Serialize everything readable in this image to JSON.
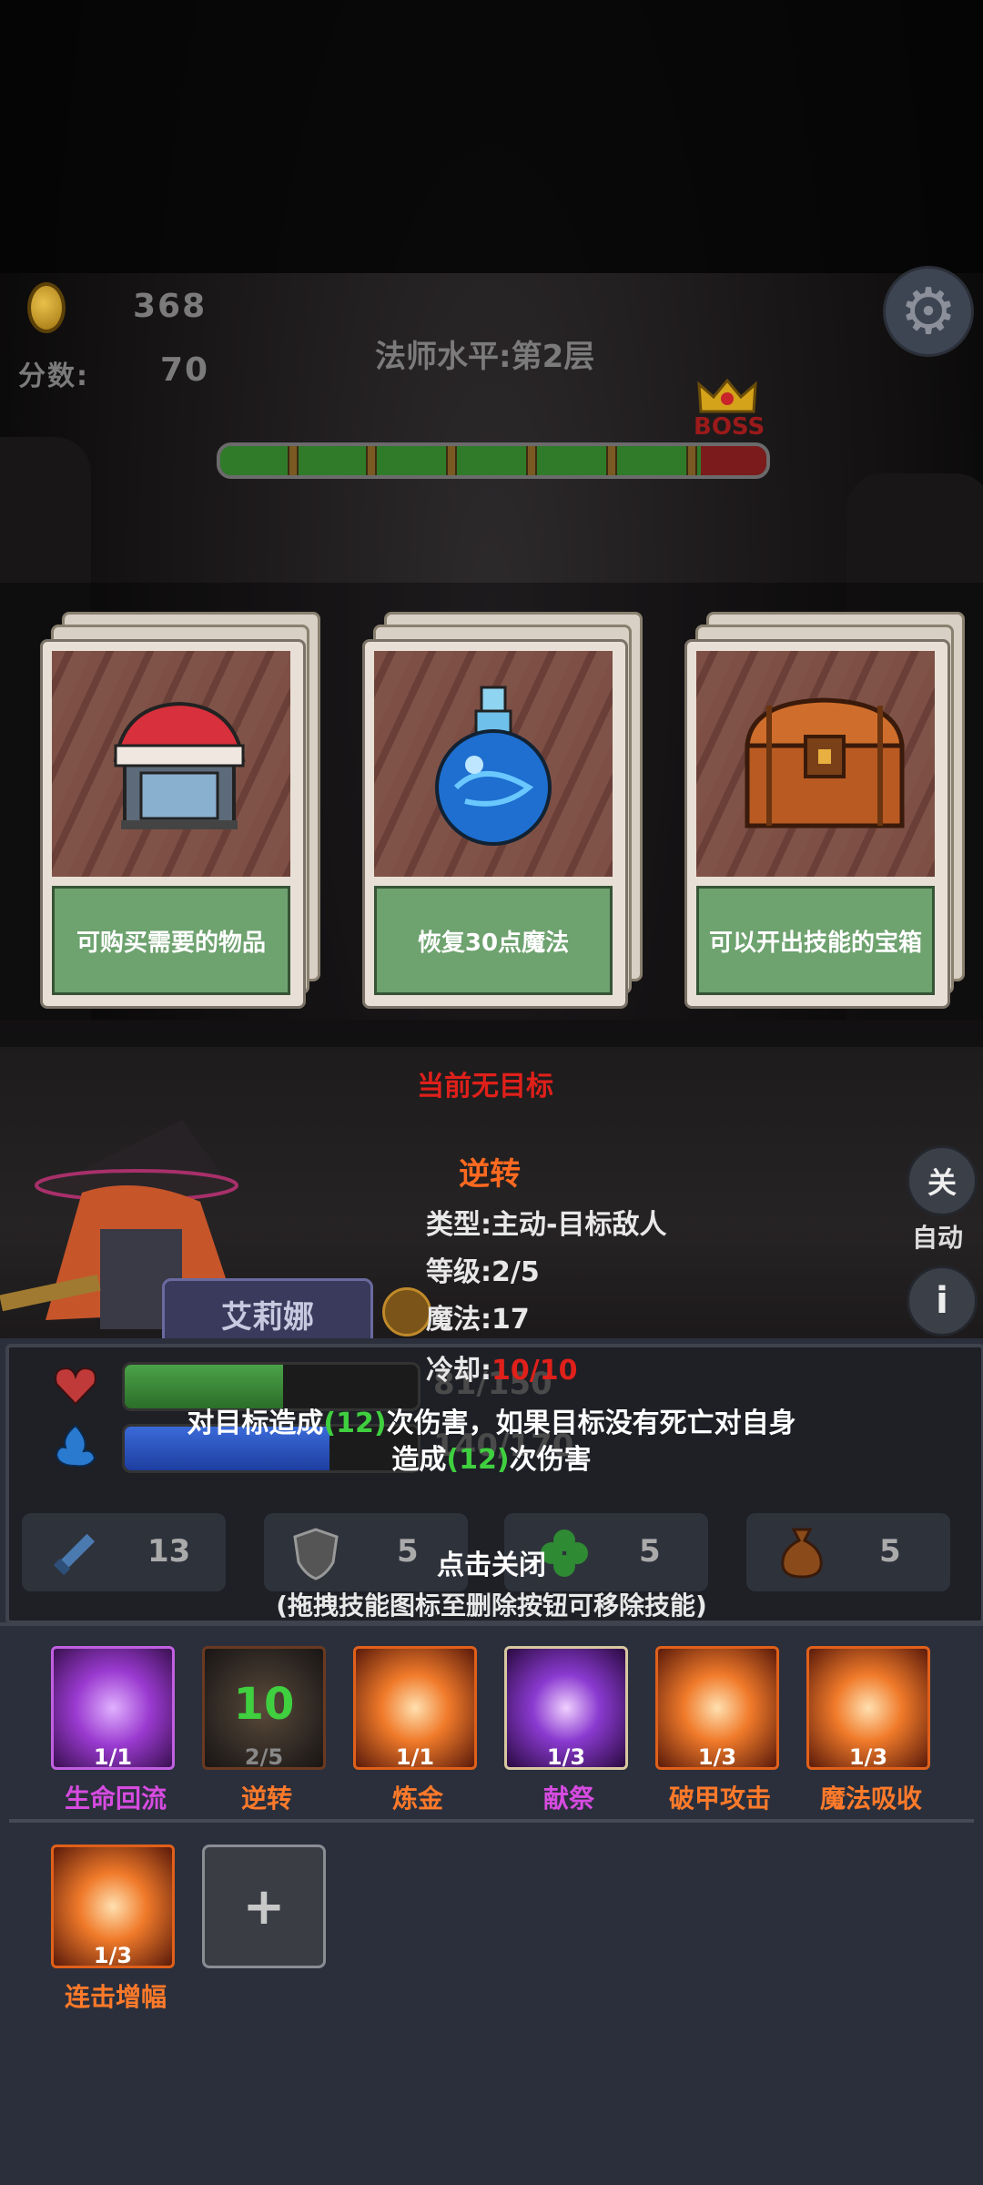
{
  "hud": {
    "coins": "368",
    "score_label": "分数:",
    "score": "70",
    "level": "法师水平:第2层",
    "boss_label": "BOSS"
  },
  "progress": {
    "fraction": 0.88
  },
  "cards": [
    {
      "caption": "可购买需要的物品",
      "icon": "shop-stall-icon"
    },
    {
      "caption": "恢复30点魔法",
      "icon": "mana-potion-icon"
    },
    {
      "caption": "可以开出技能的宝箱",
      "icon": "treasure-chest-icon"
    }
  ],
  "target_status": "当前无目标",
  "skill_detail": {
    "name": "逆转",
    "type_label": "类型:",
    "type": "主动-目标敌人",
    "level_label": "等级:",
    "level": "2/5",
    "mana_label": "魔法:",
    "mana": "17",
    "cooldown_label": "冷却:",
    "cooldown": "10/10",
    "desc_part1": "对目标造成",
    "desc_num1": "(12)",
    "desc_part2": "次伤害，如果目标没有死亡对自身",
    "desc_part3": "造成",
    "desc_num2": "(12)",
    "desc_part4": "次伤害",
    "close_hint": "点击关闭",
    "remove_hint": "(拖拽技能图标至删除按钮可移除技能)"
  },
  "side_buttons": {
    "toggle": "关",
    "auto_label": "自动",
    "info": "i"
  },
  "hero": {
    "name": "艾莉娜"
  },
  "stats": {
    "hp": "81/150",
    "hp_fraction": 0.54,
    "mp": "140/170",
    "mp_fraction": 0.7,
    "attack": "13",
    "defense": "5",
    "luck": "5",
    "bag": "5"
  },
  "skills": [
    {
      "name": "生命回流",
      "count": "1/1",
      "color": "#d64be0"
    },
    {
      "name": "逆转",
      "count": "2/5",
      "color": "#ff7a2a",
      "cooldown": "10"
    },
    {
      "name": "炼金",
      "count": "1/1",
      "color": "#ff7a2a"
    },
    {
      "name": "献祭",
      "count": "1/3",
      "color": "#d64be0"
    },
    {
      "name": "破甲攻击",
      "count": "1/3",
      "color": "#ff7a2a"
    },
    {
      "name": "魔法吸收",
      "count": "1/3",
      "color": "#ff7a2a"
    },
    {
      "name": "连击增幅",
      "count": "1/3",
      "color": "#ff7a2a"
    }
  ],
  "add_skill": "+",
  "colors": {
    "accent_green": "#3fcf3f",
    "accent_red": "#e0201a",
    "skill_orange": "#ff7a2a",
    "skill_purple": "#d64be0"
  }
}
